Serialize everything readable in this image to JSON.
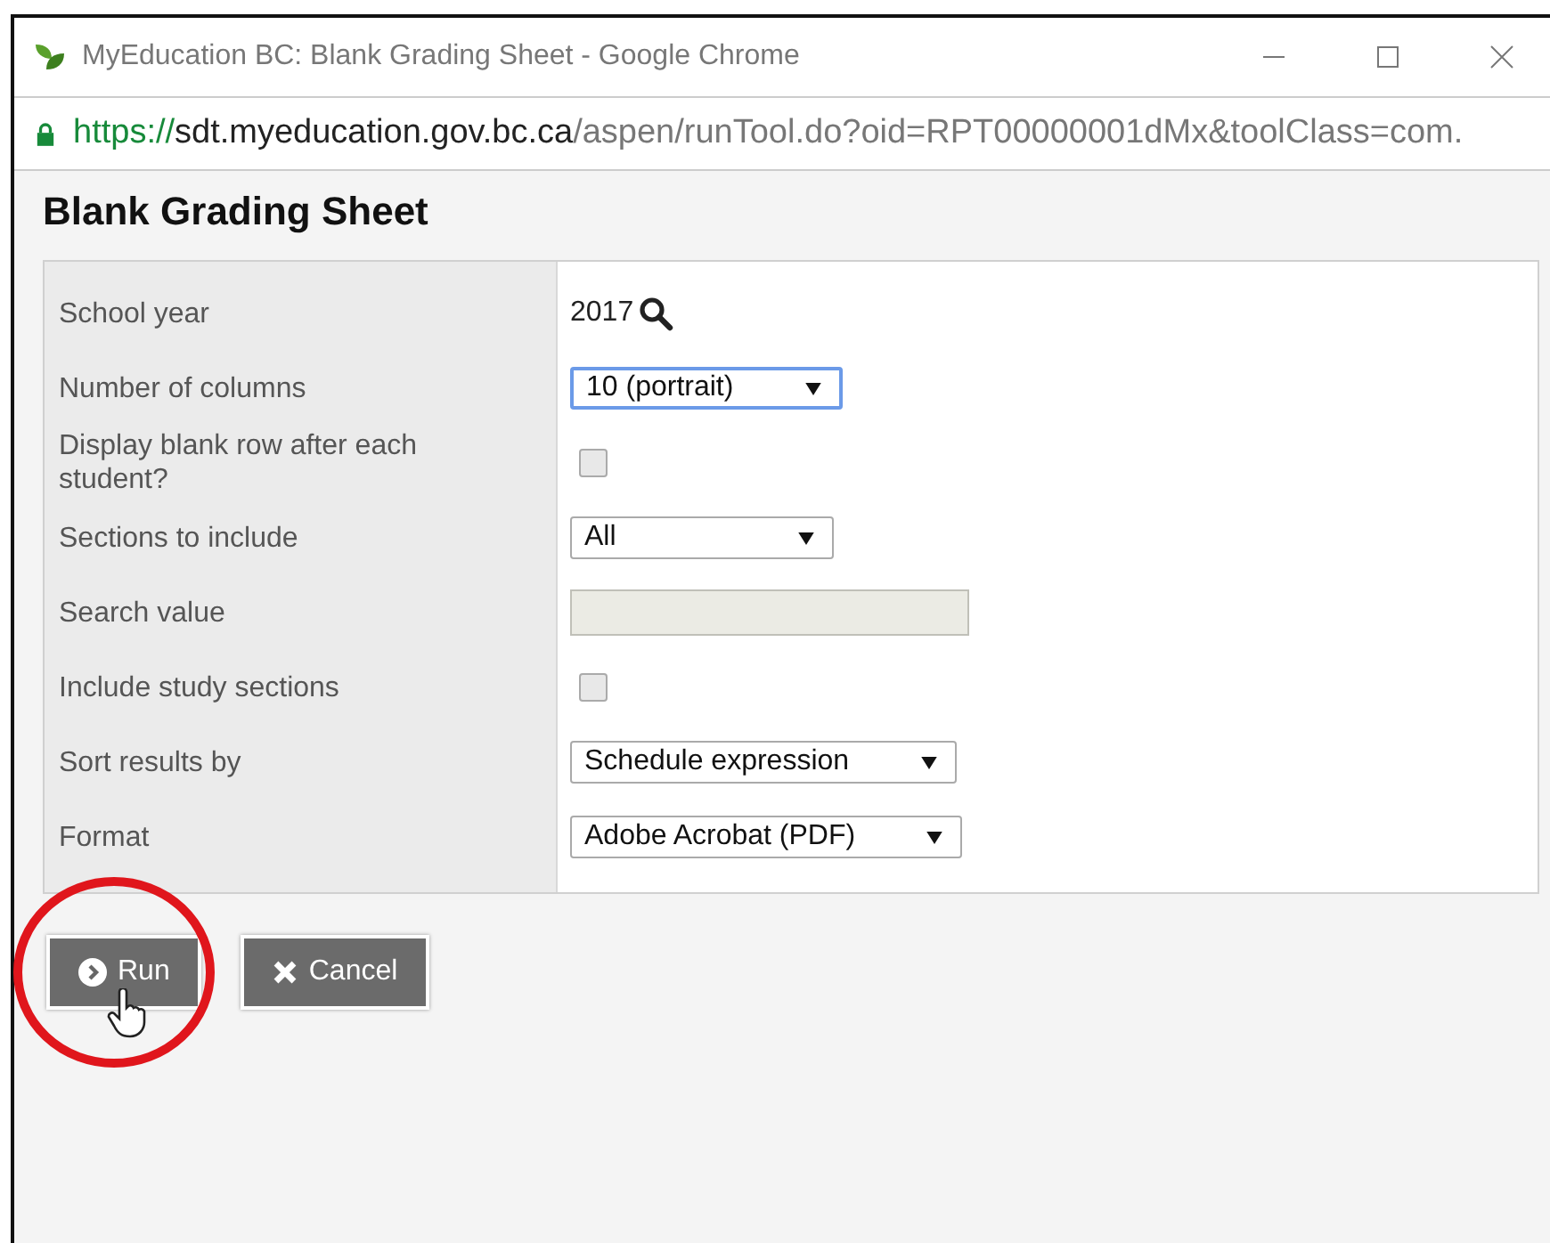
{
  "window": {
    "title": "MyEducation BC: Blank Grading Sheet - Google Chrome"
  },
  "address_bar": {
    "scheme": "https://",
    "host": "sdt.myeducation.gov.bc.ca",
    "path": "/aspen/runTool.do?oid=RPT00000001dMx&toolClass=com."
  },
  "page": {
    "heading": "Blank Grading Sheet"
  },
  "fields": [
    {
      "kind": "lookup",
      "label": "School year",
      "value": "2017"
    },
    {
      "kind": "select",
      "label": "Number of columns",
      "value": "10 (portrait)",
      "focused": true
    },
    {
      "kind": "checkbox",
      "label": "Display blank row after each student?",
      "checked": false
    },
    {
      "kind": "select",
      "label": "Sections to include",
      "value": "All",
      "focused": false
    },
    {
      "kind": "input",
      "label": "Search value",
      "disabled": true
    },
    {
      "kind": "checkbox",
      "label": "Include study sections",
      "checked": false
    },
    {
      "kind": "select",
      "label": "Sort results by",
      "value": "Schedule expression",
      "focused": false
    },
    {
      "kind": "select",
      "label": "Format",
      "value": "Adobe Acrobat (PDF)",
      "focused": false
    }
  ],
  "buttons": [
    {
      "kind": "run",
      "label": "Run",
      "highlighted": true
    },
    {
      "kind": "cancel",
      "label": "Cancel",
      "highlighted": false
    }
  ]
}
